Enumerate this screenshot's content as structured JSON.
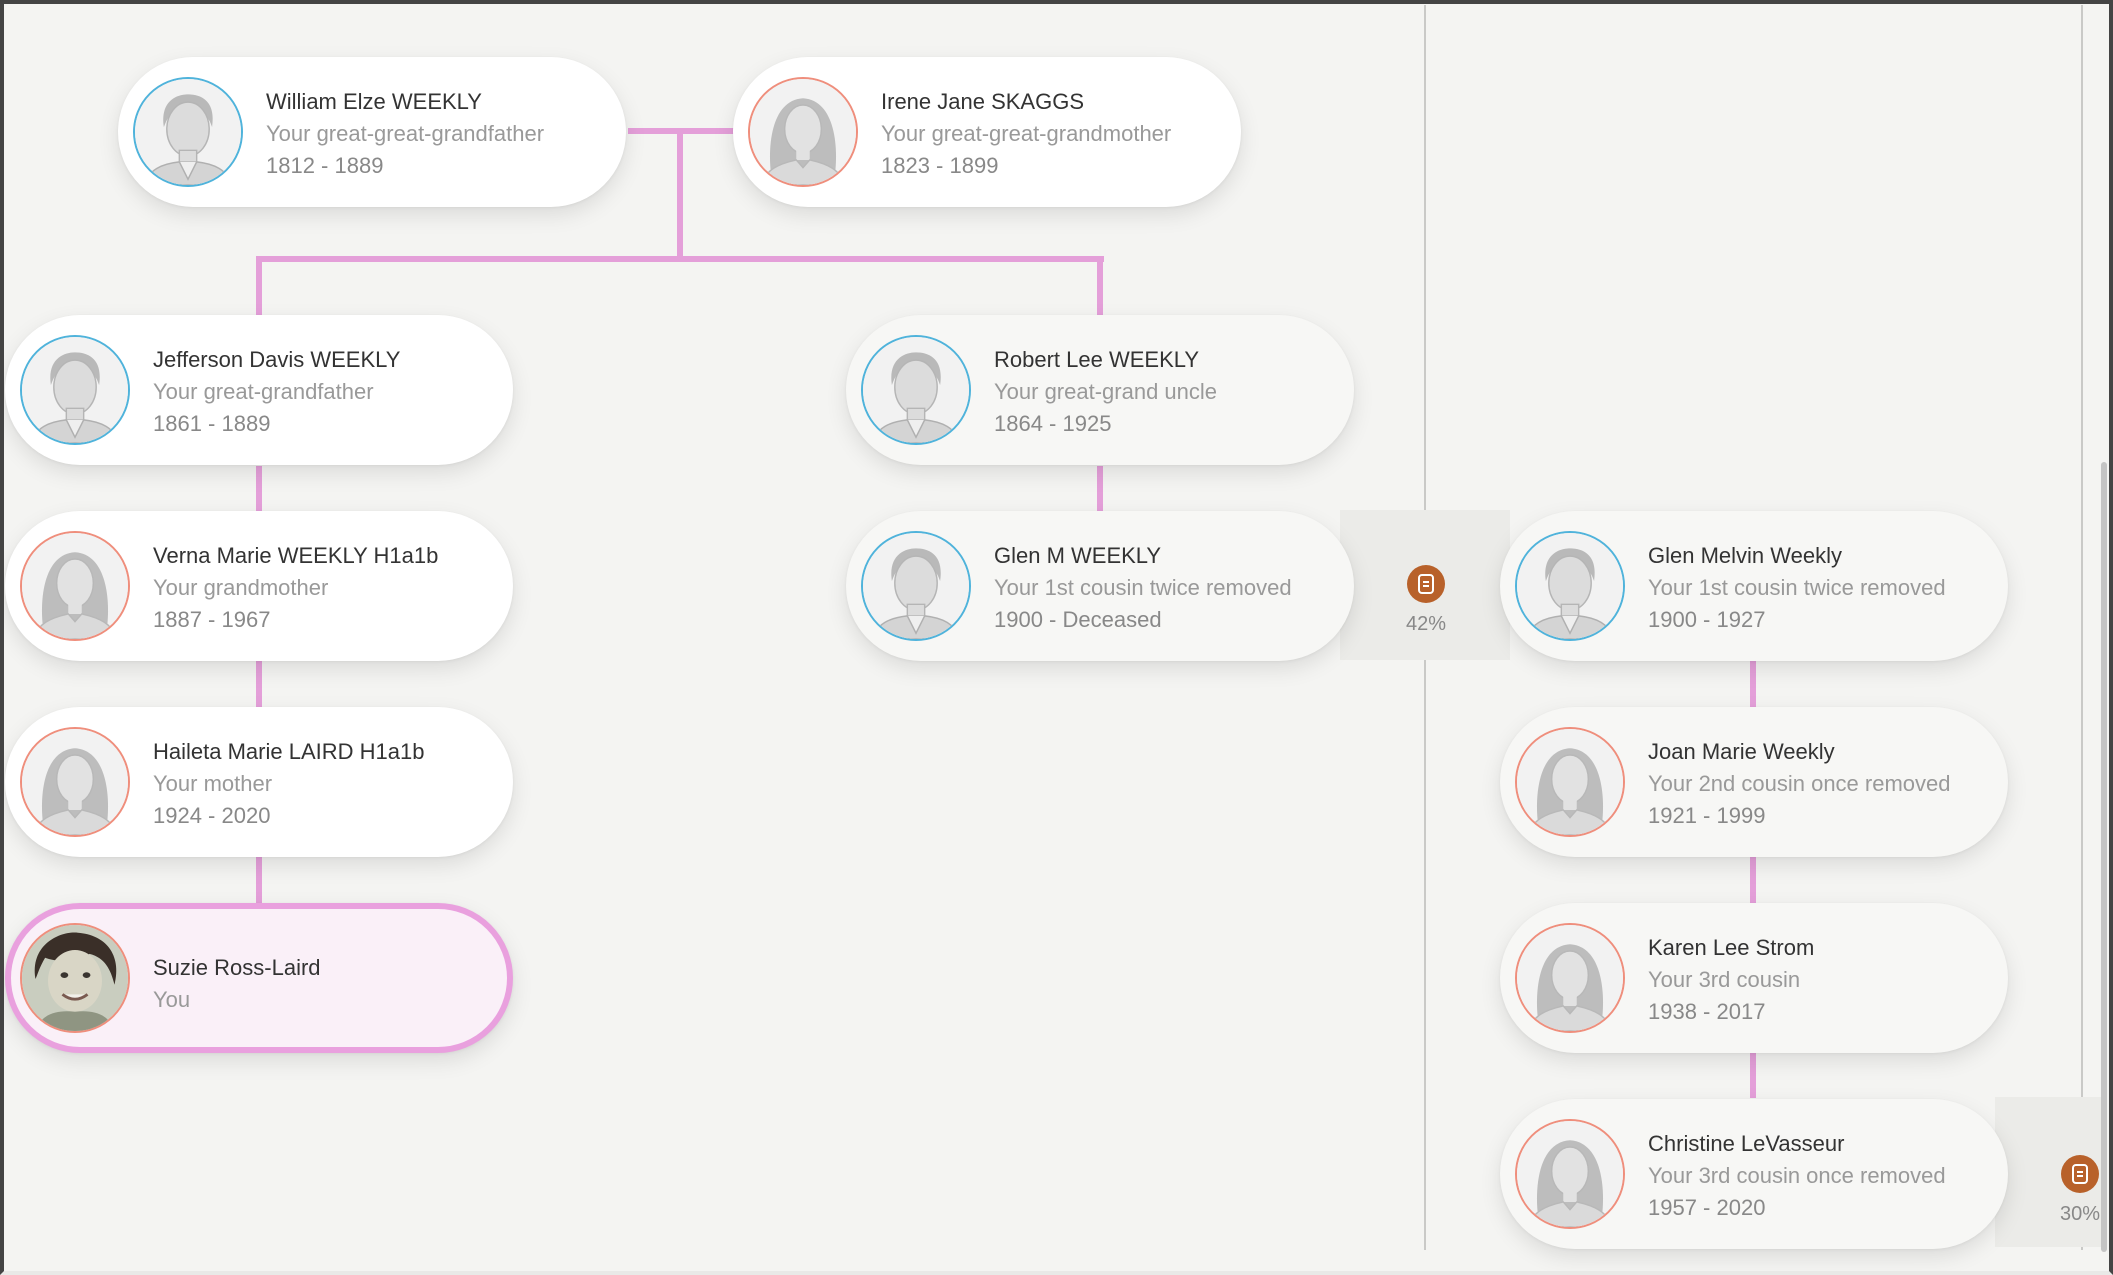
{
  "people": [
    {
      "id": "william",
      "name": "William Elze WEEKLY",
      "relationship": "Your great-great-grandfather",
      "dates": "1812 - 1889",
      "gender": "male"
    },
    {
      "id": "irene",
      "name": "Irene Jane SKAGGS",
      "relationship": "Your great-great-grandmother",
      "dates": "1823 - 1899",
      "gender": "female"
    },
    {
      "id": "jefferson",
      "name": "Jefferson Davis WEEKLY",
      "relationship": "Your great-grandfather",
      "dates": "1861 - 1889",
      "gender": "male"
    },
    {
      "id": "robert",
      "name": "Robert Lee WEEKLY",
      "relationship": "Your great-grand uncle",
      "dates": "1864 - 1925",
      "gender": "male"
    },
    {
      "id": "verna",
      "name": "Verna Marie WEEKLY H1a1b",
      "relationship": "Your grandmother",
      "dates": "1887 - 1967",
      "gender": "female"
    },
    {
      "id": "glenm",
      "name": "Glen M WEEKLY",
      "relationship": "Your 1st cousin twice removed",
      "dates": "1900 - Deceased",
      "gender": "male"
    },
    {
      "id": "glenmelvin",
      "name": "Glen Melvin Weekly",
      "relationship": "Your 1st cousin twice removed",
      "dates": "1900 - 1927",
      "gender": "male"
    },
    {
      "id": "haileta",
      "name": "Haileta Marie LAIRD H1a1b",
      "relationship": "Your mother",
      "dates": "1924 - 2020",
      "gender": "female"
    },
    {
      "id": "joan",
      "name": "Joan Marie Weekly",
      "relationship": "Your 2nd cousin once removed",
      "dates": "1921 - 1999",
      "gender": "female"
    },
    {
      "id": "suzie",
      "name": "Suzie Ross-Laird",
      "relationship": "You",
      "dates": "",
      "gender": "female"
    },
    {
      "id": "karen",
      "name": "Karen Lee Strom",
      "relationship": "Your 3rd cousin",
      "dates": "1938 - 2017",
      "gender": "female"
    },
    {
      "id": "christine",
      "name": "Christine LeVasseur",
      "relationship": "Your 3rd cousin once removed",
      "dates": "1957 - 2020",
      "gender": "female"
    }
  ],
  "matches": [
    {
      "percent": "42%",
      "icon": "document-icon"
    },
    {
      "percent": "30%",
      "icon": "document-icon"
    }
  ],
  "colors": {
    "connector": "#e49fd9",
    "male_border": "#4fb3db",
    "female_border": "#ef8e7c",
    "match_badge": "#b8612a",
    "self_background": "#faf0f8"
  }
}
